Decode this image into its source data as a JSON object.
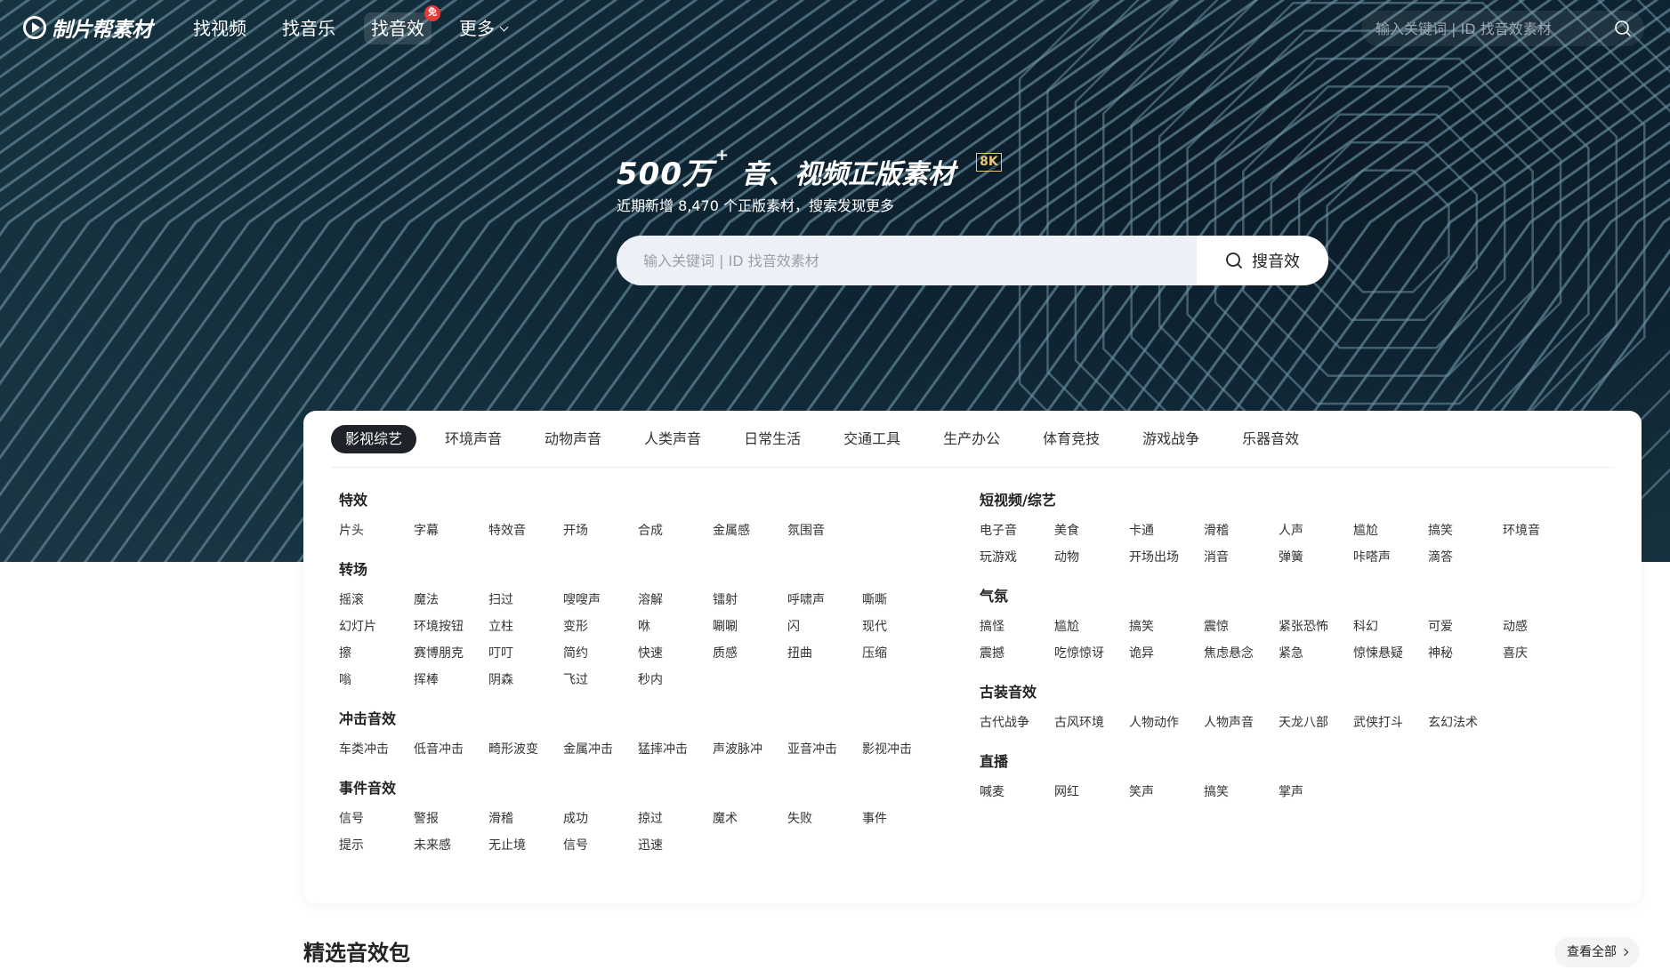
{
  "brand": {
    "logo_text": "制片帮素材"
  },
  "nav": {
    "items": [
      {
        "label": "找视频"
      },
      {
        "label": "找音乐"
      },
      {
        "label": "找音效",
        "badge": "免"
      },
      {
        "label": "更多"
      }
    ],
    "search_placeholder": "输入关键词 | ID 找音效素材"
  },
  "hero": {
    "title_num": "500万",
    "title_plus": "+",
    "title_rest": "音、视频正版素材",
    "tag": "8K",
    "subtitle": "近期新增 8,470 个正版素材，搜索发现更多",
    "search_placeholder": "输入关键词 | ID 找音效素材",
    "search_button": "搜音效"
  },
  "categories": {
    "tabs": [
      "影视综艺",
      "环境声音",
      "动物声音",
      "人类声音",
      "日常生活",
      "交通工具",
      "生产办公",
      "体育竞技",
      "游戏战争",
      "乐器音效"
    ],
    "active_tab": 0,
    "left": [
      {
        "title": "特效",
        "tags": [
          "片头",
          "字幕",
          "特效音",
          "开场",
          "合成",
          "金属感",
          "氛围音"
        ]
      },
      {
        "title": "转场",
        "tags": [
          "摇滚",
          "魔法",
          "扫过",
          "嗖嗖声",
          "溶解",
          "镭射",
          "呼啸声",
          "嘶嘶",
          "幻灯片",
          "环境按钮",
          "立柱",
          "变形",
          "咻",
          "唰唰",
          "闪",
          "现代",
          "擦",
          "赛博朋克",
          "叮叮",
          "简约",
          "快速",
          "质感",
          "扭曲",
          "压缩",
          "嗡",
          "挥棒",
          "阴森",
          "飞过",
          "秒内"
        ]
      },
      {
        "title": "冲击音效",
        "tags": [
          "车类冲击",
          "低音冲击",
          "畸形波变",
          "金属冲击",
          "猛摔冲击",
          "声波脉冲",
          "亚音冲击",
          "影视冲击"
        ]
      },
      {
        "title": "事件音效",
        "tags": [
          "信号",
          "警报",
          "滑稽",
          "成功",
          "掠过",
          "魔术",
          "失败",
          "事件",
          "提示",
          "未来感",
          "无止境",
          "信号",
          "迅速"
        ]
      }
    ],
    "right": [
      {
        "title": "短视频/综艺",
        "tags": [
          "电子音",
          "美食",
          "卡通",
          "滑稽",
          "人声",
          "尴尬",
          "搞笑",
          "环境音",
          "玩游戏",
          "动物",
          "开场出场",
          "消音",
          "弹簧",
          "咔嗒声",
          "滴答"
        ]
      },
      {
        "title": "气氛",
        "tags": [
          "搞怪",
          "尴尬",
          "搞笑",
          "震惊",
          "紧张恐怖",
          "科幻",
          "可爱",
          "动感",
          "震撼",
          "吃惊惊讶",
          "诡异",
          "焦虑悬念",
          "紧急",
          "惊悚悬疑",
          "神秘",
          "喜庆"
        ]
      },
      {
        "title": "古装音效",
        "tags": [
          "古代战争",
          "古风环境",
          "人物动作",
          "人物声音",
          "天龙八部",
          "武侠打斗",
          "玄幻法术"
        ]
      },
      {
        "title": "直播",
        "tags": [
          "喊麦",
          "网红",
          "笑声",
          "搞笑",
          "掌声"
        ]
      }
    ]
  },
  "featured": {
    "title": "精选音效包",
    "view_all": "查看全部"
  },
  "colors": {
    "hero_bg": "#16323f",
    "active_tab_bg": "#1f2228",
    "badge": "#e63b3b",
    "tag_8k": "#e8c77a"
  },
  "icons": [
    "logo-play-icon",
    "chevron-down-icon",
    "search-icon",
    "chevron-right-icon"
  ]
}
